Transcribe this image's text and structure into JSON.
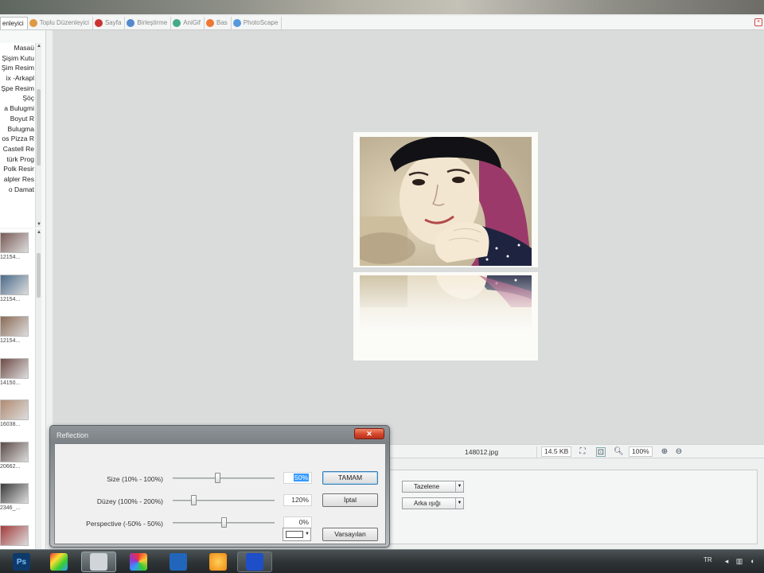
{
  "tabs": [
    {
      "label": "enleyici",
      "icon": "photo-editor-icon",
      "active": true
    },
    {
      "label": "Toplu Düzenleyici",
      "icon": "batch-editor-icon",
      "active": false
    },
    {
      "label": "Sayfa",
      "icon": "page-icon",
      "active": false
    },
    {
      "label": "Birleştirme",
      "icon": "combine-icon",
      "active": false
    },
    {
      "label": "AniGif",
      "icon": "anigif-icon",
      "active": false
    },
    {
      "label": "Bas",
      "icon": "print-icon",
      "active": false
    },
    {
      "label": "PhotoScape",
      "icon": "photoscape-icon",
      "active": false
    }
  ],
  "folders": [
    "Masaü",
    "Şişim Kutu",
    "Şim Resim",
    "ix -Arkapl",
    "Şpe Resim",
    "Şöç",
    "a Bulugmi",
    "Boyut R",
    "Bulugma",
    "os Pizza R",
    "Castell Re",
    "türk Prog",
    "Polk Resir",
    "alpler Res",
    "o Damat"
  ],
  "thumbnails": [
    {
      "caption": "12154...",
      "color": "#7a5a55"
    },
    {
      "caption": "12154...",
      "color": "#4a6a8a"
    },
    {
      "caption": "12154...",
      "color": "#8b6a55"
    },
    {
      "caption": "14150...",
      "color": "#6e4a45"
    },
    {
      "caption": "16038...",
      "color": "#b08a70"
    },
    {
      "caption": "20662...",
      "color": "#5a4a45"
    },
    {
      "caption": "2346_...",
      "color": "#3a3a3a"
    },
    {
      "caption": "",
      "color": "#a33a3a"
    }
  ],
  "status": {
    "filename": "148012.jpg",
    "filesize": "14.5 KB",
    "zoom": "100%"
  },
  "bottom_panel": {
    "frame_dropdown": "Tazelene",
    "background_dropdown": "Arka ışığı"
  },
  "dialog": {
    "title": "Reflection",
    "close_glyph": "✕",
    "params": [
      {
        "label": "Size (10% - 100%)",
        "value": "50%",
        "slider_fraction": 0.44,
        "selected": true
      },
      {
        "label": "Düzey (100% - 200%)",
        "value": "120%",
        "slider_fraction": 0.2,
        "selected": false
      },
      {
        "label": "Perspective (-50% - 50%)",
        "value": "0%",
        "slider_fraction": 0.5,
        "selected": false
      }
    ],
    "ok_label": "TAMAM",
    "cancel_label": "İptal",
    "default_label": "Varsayılan",
    "reflection_color": "#ffffff"
  },
  "taskbar": {
    "apps": [
      {
        "name": "photoshop-icon",
        "text": "Ps",
        "bg": "#0d3a6a",
        "fg": "#7fc0ff",
        "state": "normal"
      },
      {
        "name": "color-app-icon",
        "text": "",
        "bg": "linear-gradient(135deg,#e33,#fd3,#3c3,#39f)",
        "fg": "#fff",
        "state": "normal"
      },
      {
        "name": "curve-app-icon",
        "text": "",
        "bg": "#cfd5d8",
        "fg": "#c33",
        "state": "active"
      },
      {
        "name": "picasa-icon",
        "text": "",
        "bg": "conic-gradient(#e33,#fc3,#3c3,#39f,#93c,#e33)",
        "fg": "#fff",
        "state": "normal"
      },
      {
        "name": "media-app-icon",
        "text": "",
        "bg": "#2266bb",
        "fg": "#fff",
        "state": "normal"
      },
      {
        "name": "orange-app-icon",
        "text": "",
        "bg": "radial-gradient(circle,#ffcf5a,#f08a10)",
        "fg": "#fff",
        "state": "normal"
      },
      {
        "name": "photoscape-task-icon",
        "text": "",
        "bg": "#1f4fc8",
        "fg": "#fff",
        "state": "running"
      }
    ],
    "language": "TR"
  }
}
